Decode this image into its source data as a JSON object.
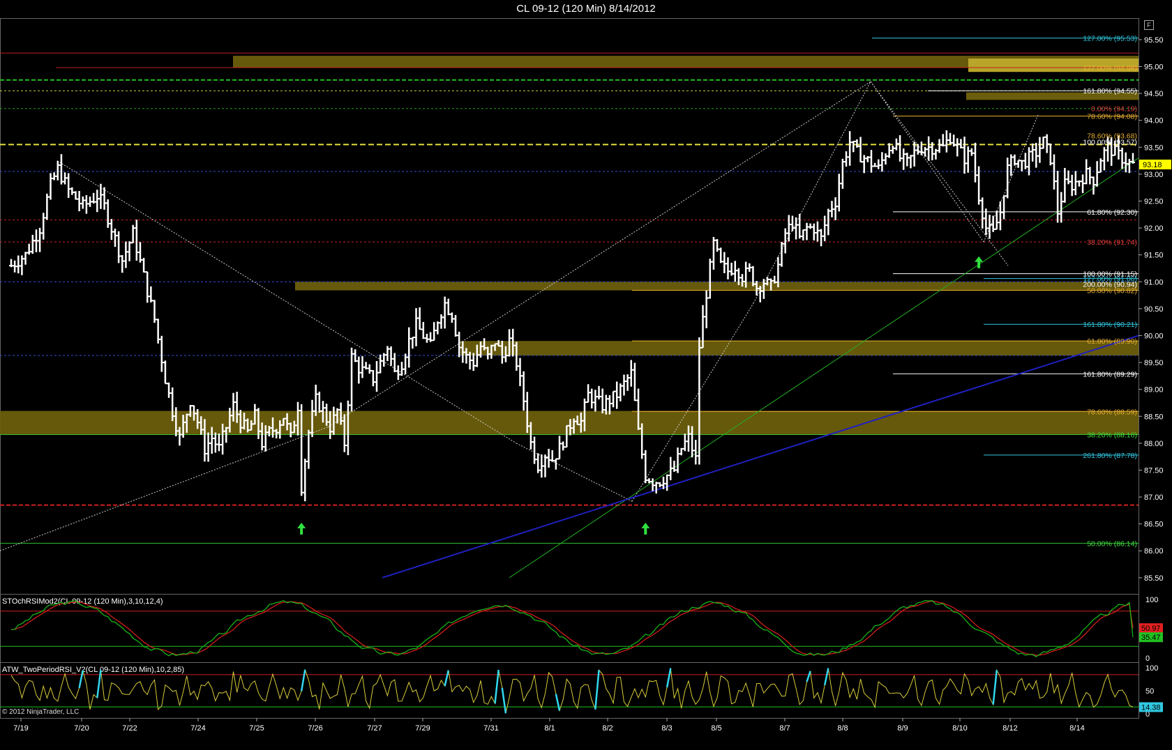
{
  "title": "CL 09-12 (120 Min)  8/14/2012",
  "copyright": "© 2012 NinjaTrader, LLC",
  "f_button": "F",
  "colors": {
    "background": "#000000",
    "bar": "#ffffff",
    "zone": "#6b5e0c",
    "stoch_k": "#17b317",
    "stoch_d": "#d11d1d",
    "rsi": "#d8cc3a",
    "rsi_extreme": "#30d8f0",
    "last_price_bg": "#ffff00"
  },
  "chart_data": {
    "type": "ohlc",
    "symbol": "CL 09-12",
    "interval": "120 Min",
    "y_ticks": [
      "95.50",
      "95.00",
      "94.50",
      "94.00",
      "93.50",
      "93.00",
      "92.50",
      "92.00",
      "91.50",
      "91.00",
      "90.50",
      "90.00",
      "89.50",
      "89.00",
      "88.50",
      "88.00",
      "87.50",
      "87.00",
      "86.50",
      "86.00",
      "85.50"
    ],
    "ylim": [
      85.2,
      95.9
    ],
    "x_ticks": [
      "7/19",
      "7/20",
      "7/22",
      "7/24",
      "7/25",
      "7/26",
      "7/27",
      "7/29",
      "7/31",
      "8/1",
      "8/2",
      "8/3",
      "8/5",
      "8/7",
      "8/8",
      "8/9",
      "8/10",
      "8/12",
      "8/14"
    ],
    "last_price": "93.18",
    "close_path": [
      [
        0,
        91.3
      ],
      [
        4,
        91.5
      ],
      [
        8,
        92.0
      ],
      [
        11,
        92.8
      ],
      [
        13,
        93.1
      ],
      [
        16,
        92.7
      ],
      [
        20,
        92.4
      ],
      [
        24,
        92.6
      ],
      [
        26,
        92.4
      ],
      [
        29,
        91.8
      ],
      [
        31,
        91.4
      ],
      [
        34,
        91.9
      ],
      [
        37,
        91.1
      ],
      [
        40,
        90.3
      ],
      [
        43,
        89.2
      ],
      [
        45,
        88.6
      ],
      [
        47,
        88.1
      ],
      [
        50,
        88.8
      ],
      [
        52,
        88.4
      ],
      [
        54,
        87.9
      ],
      [
        56,
        88.1
      ],
      [
        58,
        87.9
      ],
      [
        60,
        88.3
      ],
      [
        62,
        88.7
      ],
      [
        64,
        88.4
      ],
      [
        66,
        88.2
      ],
      [
        68,
        88.5
      ],
      [
        70,
        88.0
      ],
      [
        72,
        88.2
      ],
      [
        74,
        88.3
      ],
      [
        76,
        88.5
      ],
      [
        78,
        88.1
      ],
      [
        80,
        88.7
      ],
      [
        81,
        87.2
      ],
      [
        83,
        88.2
      ],
      [
        85,
        88.8
      ],
      [
        87,
        88.6
      ],
      [
        89,
        88.3
      ],
      [
        91,
        88.6
      ],
      [
        93,
        88.0
      ],
      [
        95,
        89.6
      ],
      [
        97,
        89.4
      ],
      [
        99,
        89.3
      ],
      [
        101,
        89.2
      ],
      [
        103,
        89.5
      ],
      [
        105,
        89.8
      ],
      [
        107,
        89.3
      ],
      [
        109,
        89.5
      ],
      [
        111,
        89.9
      ],
      [
        113,
        90.2
      ],
      [
        115,
        90.0
      ],
      [
        117,
        89.8
      ],
      [
        119,
        90.3
      ],
      [
        121,
        90.6
      ],
      [
        123,
        90.4
      ],
      [
        125,
        89.8
      ],
      [
        127,
        89.6
      ],
      [
        129,
        89.5
      ],
      [
        131,
        89.8
      ],
      [
        133,
        89.6
      ],
      [
        135,
        89.9
      ],
      [
        137,
        89.6
      ],
      [
        139,
        89.9
      ],
      [
        141,
        89.5
      ],
      [
        143,
        88.8
      ],
      [
        145,
        88.0
      ],
      [
        147,
        87.6
      ],
      [
        149,
        87.8
      ],
      [
        151,
        87.7
      ],
      [
        153,
        87.9
      ],
      [
        155,
        88.2
      ],
      [
        157,
        88.5
      ],
      [
        159,
        88.4
      ],
      [
        161,
        88.9
      ],
      [
        163,
        88.8
      ],
      [
        165,
        88.7
      ],
      [
        167,
        88.8
      ],
      [
        169,
        88.9
      ],
      [
        171,
        89.1
      ],
      [
        173,
        89.3
      ],
      [
        175,
        88.2
      ],
      [
        177,
        87.4
      ],
      [
        179,
        87.3
      ],
      [
        181,
        87.3
      ],
      [
        183,
        87.4
      ],
      [
        185,
        87.5
      ],
      [
        187,
        87.9
      ],
      [
        189,
        88.1
      ],
      [
        191,
        87.7
      ],
      [
        192,
        89.8
      ],
      [
        194,
        90.8
      ],
      [
        196,
        91.7
      ],
      [
        198,
        91.3
      ],
      [
        200,
        91.2
      ],
      [
        202,
        91.3
      ],
      [
        204,
        91.1
      ],
      [
        206,
        91.2
      ],
      [
        208,
        90.9
      ],
      [
        210,
        91.0
      ],
      [
        212,
        90.9
      ],
      [
        214,
        91.3
      ],
      [
        216,
        91.9
      ],
      [
        218,
        92.1
      ],
      [
        220,
        91.8
      ],
      [
        222,
        92.0
      ],
      [
        224,
        92.0
      ],
      [
        226,
        91.8
      ],
      [
        228,
        92.3
      ],
      [
        230,
        92.5
      ],
      [
        232,
        93.2
      ],
      [
        234,
        93.6
      ],
      [
        236,
        93.4
      ],
      [
        238,
        93.3
      ],
      [
        240,
        93.2
      ],
      [
        242,
        93.1
      ],
      [
        244,
        93.4
      ],
      [
        246,
        93.6
      ],
      [
        248,
        93.3
      ],
      [
        250,
        93.2
      ],
      [
        252,
        93.4
      ],
      [
        254,
        93.5
      ],
      [
        256,
        93.5
      ],
      [
        258,
        93.5
      ],
      [
        260,
        93.5
      ],
      [
        262,
        93.7
      ],
      [
        264,
        93.5
      ],
      [
        266,
        93.3
      ],
      [
        268,
        93.4
      ],
      [
        270,
        92.6
      ],
      [
        272,
        92.0
      ],
      [
        274,
        91.9
      ],
      [
        276,
        92.3
      ],
      [
        278,
        93.1
      ],
      [
        280,
        93.3
      ],
      [
        282,
        93.2
      ],
      [
        284,
        93.3
      ],
      [
        286,
        93.4
      ],
      [
        288,
        93.6
      ],
      [
        290,
        93.3
      ],
      [
        292,
        92.3
      ],
      [
        294,
        92.8
      ],
      [
        296,
        92.8
      ],
      [
        298,
        92.9
      ],
      [
        300,
        93.0
      ],
      [
        302,
        92.9
      ],
      [
        304,
        93.3
      ],
      [
        306,
        93.5
      ],
      [
        308,
        93.4
      ],
      [
        310,
        93.3
      ],
      [
        312,
        93.2
      ],
      [
        313,
        93.18
      ]
    ],
    "bar_count": 314,
    "fib_labels": [
      {
        "text": "127.00% (95.53)",
        "price": 95.53,
        "color": "#30c8e0"
      },
      {
        "text": "127.00% (94.98)",
        "price": 94.98,
        "color": "#e8b030"
      },
      {
        "text": "161.80% (94.55)",
        "price": 94.55,
        "color": "#ffffff"
      },
      {
        "text": "0.00% (94.19)",
        "price": 94.22,
        "color": "#e04040"
      },
      {
        "text": "78.60% (94.08)",
        "price": 94.08,
        "color": "#e8b030"
      },
      {
        "text": "78.60% (93.68)",
        "price": 93.72,
        "color": "#e8b030"
      },
      {
        "text": "100.00% (93.57)",
        "price": 93.6,
        "color": "#ffffff"
      },
      {
        "text": "61.80% (92.30)",
        "price": 92.3,
        "color": "#ffffff"
      },
      {
        "text": "38.20% (91.74)",
        "price": 91.74,
        "color": "#e04040"
      },
      {
        "text": "100.00% (91.15)",
        "price": 91.15,
        "color": "#ffffff"
      },
      {
        "text": "127.00% (91.06)",
        "price": 91.06,
        "color": "#30c8e0"
      },
      {
        "text": "200.00% (90.94)",
        "price": 90.96,
        "color": "#ffffff"
      },
      {
        "text": "50.00% (90.82)",
        "price": 90.84,
        "color": "#e8b030"
      },
      {
        "text": "161.80% (90.21)",
        "price": 90.21,
        "color": "#30c8e0"
      },
      {
        "text": "61.80% (89.90)",
        "price": 89.9,
        "color": "#e8b030"
      },
      {
        "text": "161.80% (89.29)",
        "price": 89.29,
        "color": "#ffffff"
      },
      {
        "text": "78.60% (88.59)",
        "price": 88.59,
        "color": "#e8b030"
      },
      {
        "text": "38.20% (88.16)",
        "price": 88.16,
        "color": "#40e040"
      },
      {
        "text": "261.80% (87.78)",
        "price": 87.78,
        "color": "#30c8e0"
      },
      {
        "text": "50.00% (86.14)",
        "price": 86.14,
        "color": "#40e040"
      }
    ],
    "zones": [
      {
        "from": 94.98,
        "to": 95.2,
        "color": "#6b5e0c"
      },
      {
        "from": 90.84,
        "to": 91.0,
        "color": "#6b5e0c"
      },
      {
        "from": 89.63,
        "to": 89.9,
        "color": "#6b5e0c"
      },
      {
        "from": 88.16,
        "to": 88.6,
        "color": "#6b5e0c"
      }
    ],
    "signal_arrows": [
      81,
      177,
      270
    ],
    "indicators": [
      {
        "name": "STOchRSIMod2(CL 09-12 (120 Min),3,10,12,4)",
        "y_ticks": [
          "100",
          "50",
          "0"
        ],
        "ylim": [
          0,
          100
        ],
        "upper": 80,
        "lower": 20,
        "last_values": [
          "50.97",
          "35.47"
        ]
      },
      {
        "name": "ATW_TwoPeriodRSI_V2(CL 09-12 (120 Min),10,2,85)",
        "y_ticks": [
          "100",
          "50",
          "0"
        ],
        "ylim": [
          0,
          100
        ],
        "upper": 85,
        "lower": 15,
        "last_values": [
          "14.38"
        ]
      }
    ]
  }
}
